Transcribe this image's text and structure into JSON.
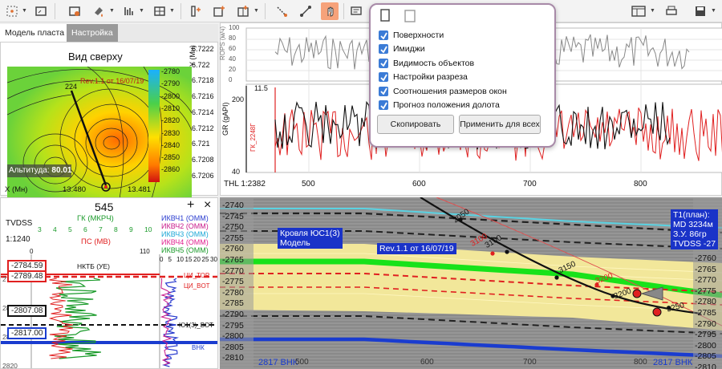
{
  "toolbar": {
    "icons": [
      "frame-select-icon",
      "fit-view-icon",
      "settings-icon",
      "paint-icon",
      "table-icon",
      "add-track-icon",
      "add-grid-icon",
      "line-tool-icon",
      "polyline-tool-icon",
      "hand-tool-icon",
      "comment-icon",
      "copy-icon",
      "paste-icon",
      "undo-icon",
      "redo-icon",
      "window-layout-icon",
      "print-icon",
      "save-icon"
    ]
  },
  "tabs": [
    {
      "label": "Модель пласта"
    },
    {
      "label": "Настройка"
    }
  ],
  "map": {
    "title": "Вид сверху",
    "y_axis_label": "Y (Мн)",
    "x_axis_label": "X (Мн)",
    "x_ticks": [
      "13.480",
      "13.481"
    ],
    "y_ticks": [
      "6.7222",
      "6.722",
      "6.7218",
      "6.7216",
      "6.7214",
      "6.7212",
      "6.721",
      "6.7208",
      "6.7206"
    ],
    "colorbar": [
      "-2780",
      "-2790",
      "-2800",
      "-2810",
      "-2820",
      "-2830",
      "-2840",
      "-2850",
      "-2860"
    ],
    "altitude_label": "Альтитуда:",
    "altitude_value": "80.01",
    "well_label": "Rev.1.1 от 16/07/19",
    "well_number": "224"
  },
  "top_chart": {
    "rops_label": "ROPS (м/ч)",
    "rops_ticks": [
      "100",
      "80",
      "60",
      "40",
      "20",
      "0"
    ],
    "gr_label": "GR (gAPI)",
    "gr_ticks": [
      "200",
      "40"
    ],
    "gk_label": "ГК_2248Г",
    "gk_ticks": [
      "11.5",
      "1.0"
    ],
    "thl_label": "THL",
    "scale": "1:2382",
    "x_ticks": [
      "500",
      "600",
      "700",
      "800"
    ]
  },
  "popup": {
    "items": [
      "Поверхности",
      "Имиджи",
      "Видимость объектов",
      "Настройки разреза",
      "Соотношения размеров окон",
      "Прогноз положения долота"
    ],
    "btn_copy": "Скопировать",
    "btn_apply": "Применить для всех"
  },
  "log": {
    "well": "545",
    "plus": "+",
    "close": "×",
    "tvdss": "TVDSS",
    "scale": "1:1240",
    "gk_label": "ГК (МКРЧ)",
    "gk_ticks": [
      "3",
      "4",
      "5",
      "6",
      "7",
      "8",
      "9",
      "10"
    ],
    "ps_label": "ПС (МВ)",
    "ps_ticks": [
      "0",
      "110"
    ],
    "ikvch": [
      {
        "label": "ИКВЧ1 (ОММ)",
        "color": "#2a3ccf"
      },
      {
        "label": "ИКВЧ2 (ОММ)",
        "color": "#c8198a"
      },
      {
        "label": "ИКВЧ3 (ОММ)",
        "color": "#1aa7d6"
      },
      {
        "label": "ИКВЧ4 (ОММ)",
        "color": "#e0208f"
      },
      {
        "label": "ИКВЧ5 (ОММ)",
        "color": "#1a9a2a"
      }
    ],
    "ikvch_ticks": [
      "0",
      "5",
      "10",
      "15",
      "20",
      "25",
      "30"
    ],
    "depth_ticks": [
      "2790",
      "2800",
      "2810",
      "2820"
    ],
    "markers": [
      {
        "value": "-2784.59",
        "color": "#e0202a"
      },
      {
        "value": "-2789.48",
        "color": "#e0202a"
      },
      {
        "value": "-2807.08",
        "color": "#111"
      },
      {
        "value": "-2817.00",
        "color": "#1a3ccf"
      }
    ],
    "zones": [
      "НКТБ (УЕ)",
      "ЦИ_ТОР",
      "ЦИ_BOT",
      "Ю1(3)_ВОТ",
      "ВНК"
    ]
  },
  "section": {
    "depth_ticks": [
      "-2740",
      "-2745",
      "-2750",
      "-2755",
      "-2760",
      "-2765",
      "-2770",
      "-2775",
      "-2780",
      "-2785",
      "-2790",
      "-2795",
      "-2800",
      "-2805",
      "-2810"
    ],
    "right_ticks": [
      "-2760",
      "-2765",
      "-2770",
      "-2775",
      "-2780",
      "-2785",
      "-2790",
      "-2795",
      "-2800",
      "-2805",
      "-2810"
    ],
    "x_ticks": [
      "500",
      "600",
      "700",
      "800"
    ],
    "model_label": "Кровля ЮС1(3)\nМодель",
    "rev_label": "Rev.1.1 от 16/07/19",
    "plan_label": "Т1(план):\nMD 3234м\nЗ.У. 86гр\nTVDSS -27",
    "right_label": "Т1\nMD\nЗУ\nА.С",
    "md_black": [
      "2050",
      "3100",
      "3150",
      "3200",
      "3250"
    ],
    "md_red": [
      "3100",
      "3200"
    ],
    "bottom_left": "2817 ВНК",
    "bottom_right": "2817 ВНК"
  }
}
